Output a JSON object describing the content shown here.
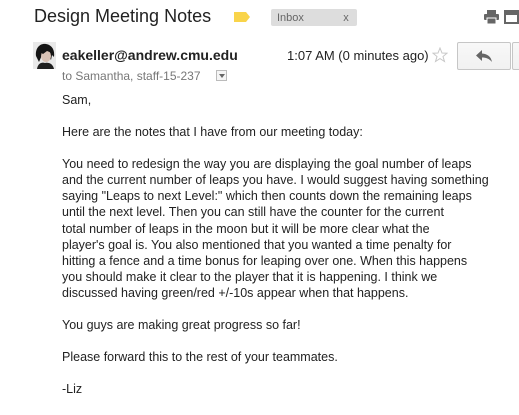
{
  "header": {
    "subject": "Design Meeting Notes",
    "label": "Inbox",
    "label_remove": "x"
  },
  "message": {
    "sender": "eakeller@andrew.cmu.edu",
    "time": "1:07 AM (0 minutes ago)",
    "recipients": "to Samantha, staff-15-237",
    "body": {
      "greeting": "Sam,",
      "paragraphs": [
        "Here are the notes that I have from our meeting today:",
        "You need to redesign the way you are displaying the goal number of leaps\nand the current number of leaps you have. I would suggest having something\nsaying \"Leaps to next Level:\" which then counts down the remaining leaps\nuntil the next level. Then you can still have the counter for the current\ntotal number of leaps in the moon but it will be more clear what the\nplayer's goal is. You also mentioned that you wanted a time penalty for\nhitting a fence and a time bonus for leaping over one. When this happens\nyou should make it clear to the player that it is happening. I think we\ndiscussed having green/red +/-10s appear when that happens.",
        "You guys are making great progress so far!",
        "Please forward this to the rest of your teammates."
      ],
      "signature": "-Liz"
    }
  },
  "icons": {
    "importance": "importance-marker-icon",
    "print": "print-icon",
    "new_window": "new-window-icon",
    "star": "star-icon",
    "reply": "reply-arrow-icon",
    "details": "chevron-down-icon"
  },
  "colors": {
    "importance_marker": "#f9d44a",
    "label_bg": "#dddddd",
    "text": "#222222",
    "muted": "#777777"
  }
}
